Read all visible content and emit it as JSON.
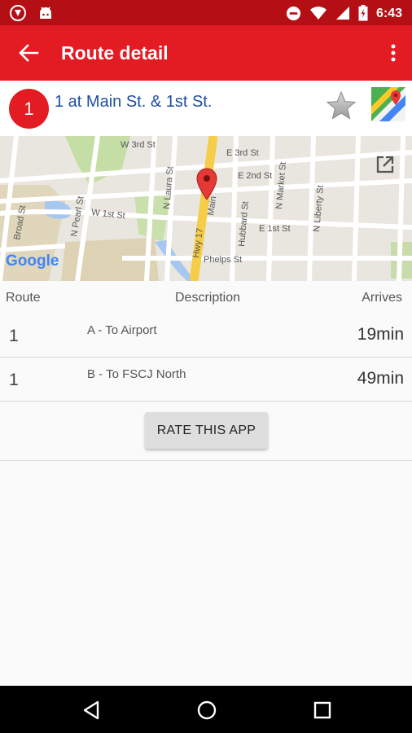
{
  "status_bar": {
    "time": "6:43",
    "left_icons": [
      "shield-notification-icon",
      "android-notification-icon"
    ],
    "right_icons": [
      "do-not-disturb-icon",
      "wifi-icon",
      "signal-icon",
      "battery-icon"
    ]
  },
  "app_bar": {
    "title": "Route detail",
    "back_icon": "arrow-back-icon",
    "menu_icon": "overflow-menu-icon"
  },
  "stop": {
    "badge": "1",
    "name": "1 at Main St. & 1st St."
  },
  "map": {
    "attribution": "Google",
    "streets": [
      "W 3rd St",
      "E 3rd St",
      "E 2nd St",
      "N Laura St",
      "N Market St",
      "N Liberty St",
      "W 1st St",
      "E 1st St",
      "Broad St",
      "N Pearl St",
      "Hubbard St",
      "Hwy 17",
      "Main",
      "Phelps St"
    ]
  },
  "table": {
    "headers": {
      "route": "Route",
      "description": "Description",
      "arrives": "Arrives"
    },
    "rows": [
      {
        "route": "1",
        "description": "A - To Airport",
        "arrives": "19min"
      },
      {
        "route": "1",
        "description": "B - To FSCJ North",
        "arrives": "49min"
      }
    ]
  },
  "rate_button": "RATE THIS APP",
  "colors": {
    "accent": "#e31b23",
    "status_bar": "#b30f14",
    "stop_name": "#1f4e9e"
  }
}
